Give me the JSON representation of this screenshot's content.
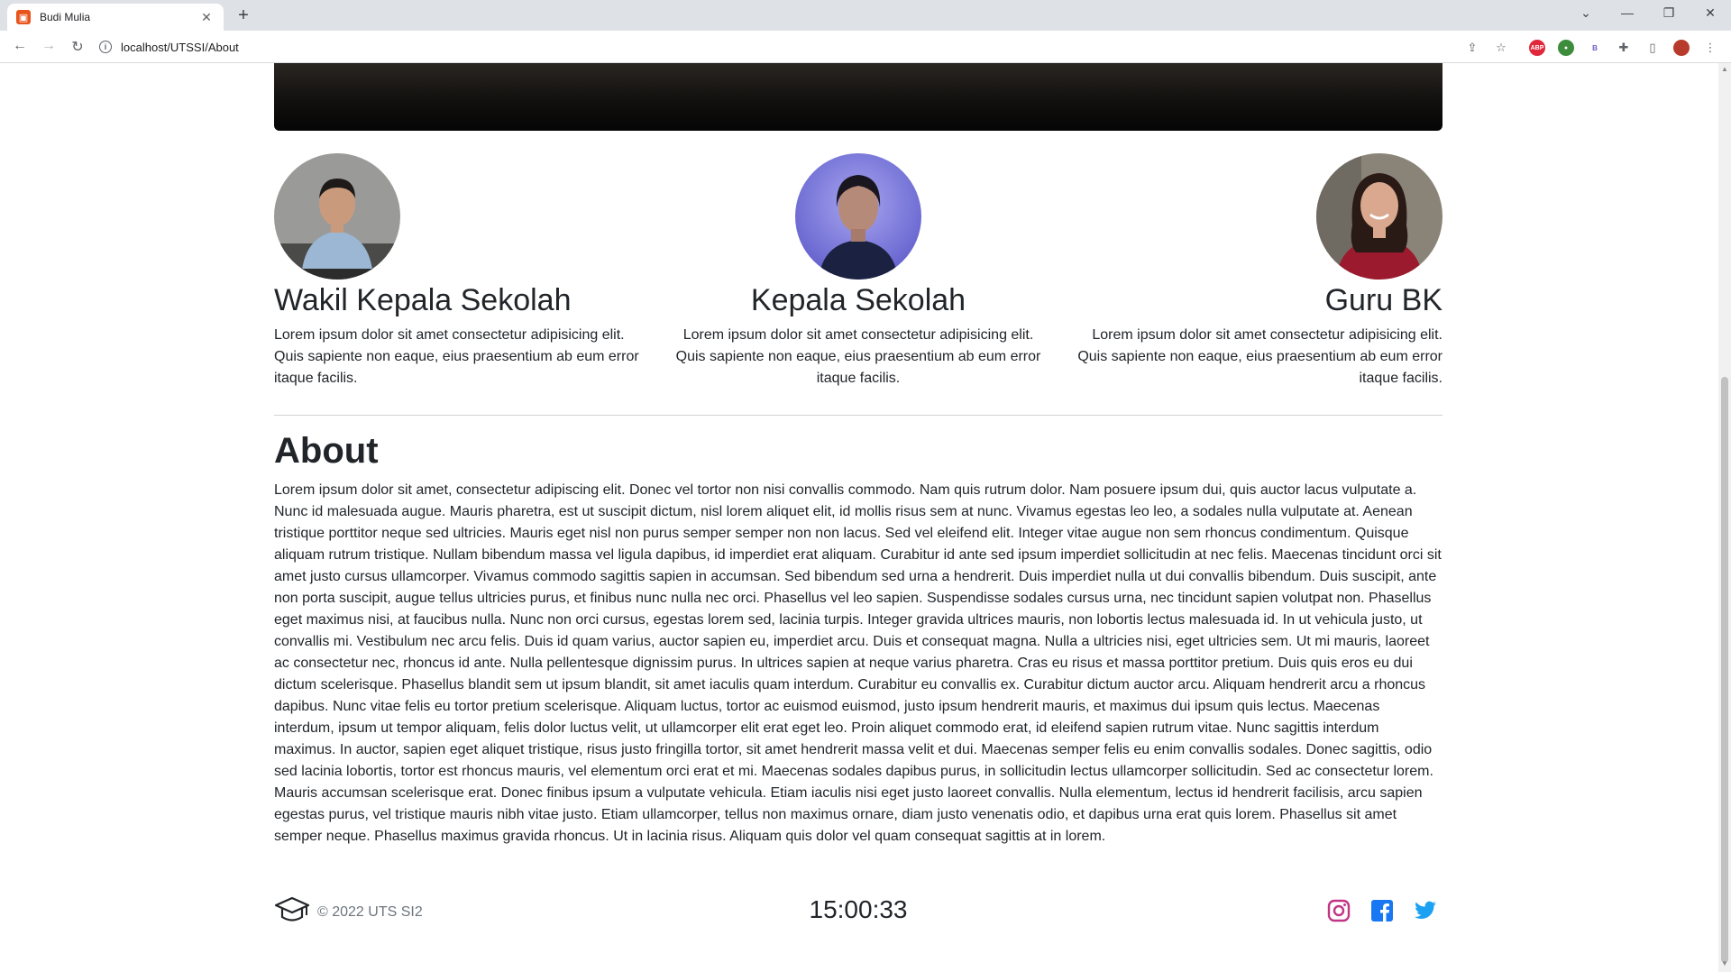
{
  "browser": {
    "tab_title": "Budi Mulia",
    "url": "localhost/UTSSI/About",
    "extension_abp": "ABP",
    "extension_b": "B"
  },
  "people": [
    {
      "role": "Wakil Kepala Sekolah",
      "text": "Lorem ipsum dolor sit amet consectetur adipisicing elit. Quis sapiente non eaque, eius praesentium ab eum error itaque facilis."
    },
    {
      "role": "Kepala Sekolah",
      "text": "Lorem ipsum dolor sit amet consectetur adipisicing elit. Quis sapiente non eaque, eius praesentium ab eum error itaque facilis."
    },
    {
      "role": "Guru BK",
      "text": "Lorem ipsum dolor sit amet consectetur adipisicing elit. Quis sapiente non eaque, eius praesentium ab eum error itaque facilis."
    }
  ],
  "about": {
    "title": "About",
    "text": "Lorem ipsum dolor sit amet, consectetur adipiscing elit. Donec vel tortor non nisi convallis commodo. Nam quis rutrum dolor. Nam posuere ipsum dui, quis auctor lacus vulputate a. Nunc id malesuada augue. Mauris pharetra, est ut suscipit dictum, nisl lorem aliquet elit, id mollis risus sem at nunc. Vivamus egestas leo leo, a sodales nulla vulputate at. Aenean tristique porttitor neque sed ultricies. Mauris eget nisl non purus semper semper non non lacus. Sed vel eleifend elit. Integer vitae augue non sem rhoncus condimentum. Quisque aliquam rutrum tristique. Nullam bibendum massa vel ligula dapibus, id imperdiet erat aliquam. Curabitur id ante sed ipsum imperdiet sollicitudin at nec felis. Maecenas tincidunt orci sit amet justo cursus ullamcorper. Vivamus commodo sagittis sapien in accumsan. Sed bibendum sed urna a hendrerit. Duis imperdiet nulla ut dui convallis bibendum. Duis suscipit, ante non porta suscipit, augue tellus ultricies purus, et finibus nunc nulla nec orci. Phasellus vel leo sapien. Suspendisse sodales cursus urna, nec tincidunt sapien volutpat non. Phasellus eget maximus nisi, at faucibus nulla. Nunc non orci cursus, egestas lorem sed, lacinia turpis. Integer gravida ultrices mauris, non lobortis lectus malesuada id. In ut vehicula justo, ut convallis mi. Vestibulum nec arcu felis. Duis id quam varius, auctor sapien eu, imperdiet arcu. Duis et consequat magna. Nulla a ultricies nisi, eget ultricies sem. Ut mi mauris, laoreet ac consectetur nec, rhoncus id ante. Nulla pellentesque dignissim purus. In ultrices sapien at neque varius pharetra. Cras eu risus et massa porttitor pretium. Duis quis eros eu dui dictum scelerisque. Phasellus blandit sem ut ipsum blandit, sit amet iaculis quam interdum. Curabitur eu convallis ex. Curabitur dictum auctor arcu. Aliquam hendrerit arcu a rhoncus dapibus. Nunc vitae felis eu tortor pretium scelerisque. Aliquam luctus, tortor ac euismod euismod, justo ipsum hendrerit mauris, et maximus dui ipsum quis lectus. Maecenas interdum, ipsum ut tempor aliquam, felis dolor luctus velit, ut ullamcorper elit erat eget leo. Proin aliquet commodo erat, id eleifend sapien rutrum vitae. Nunc sagittis interdum maximus. In auctor, sapien eget aliquet tristique, risus justo fringilla tortor, sit amet hendrerit massa velit et dui. Maecenas semper felis eu enim convallis sodales. Donec sagittis, odio sed lacinia lobortis, tortor est rhoncus mauris, vel elementum orci erat et mi. Maecenas sodales dapibus purus, in sollicitudin lectus ullamcorper sollicitudin. Sed ac consectetur lorem. Mauris accumsan scelerisque erat. Donec finibus ipsum a vulputate vehicula. Etiam iaculis nisi eget justo laoreet convallis. Nulla elementum, lectus id hendrerit facilisis, arcu sapien egestas purus, vel tristique mauris nibh vitae justo. Etiam ullamcorper, tellus non maximus ornare, diam justo venenatis odio, et dapibus urna erat quis lorem. Phasellus sit amet semper neque. Phasellus maximus gravida rhoncus. Ut in lacinia risus. Aliquam quis dolor vel quam consequat sagittis at in lorem."
  },
  "footer": {
    "copyright": "© 2022 UTS SI2",
    "clock": "15:00:33",
    "icons": [
      "graduation-cap-icon",
      "instagram-icon",
      "facebook-icon",
      "twitter-icon"
    ]
  },
  "colors": {
    "instagram": "#c13584",
    "facebook": "#1877f2",
    "twitter": "#1da1f2"
  }
}
